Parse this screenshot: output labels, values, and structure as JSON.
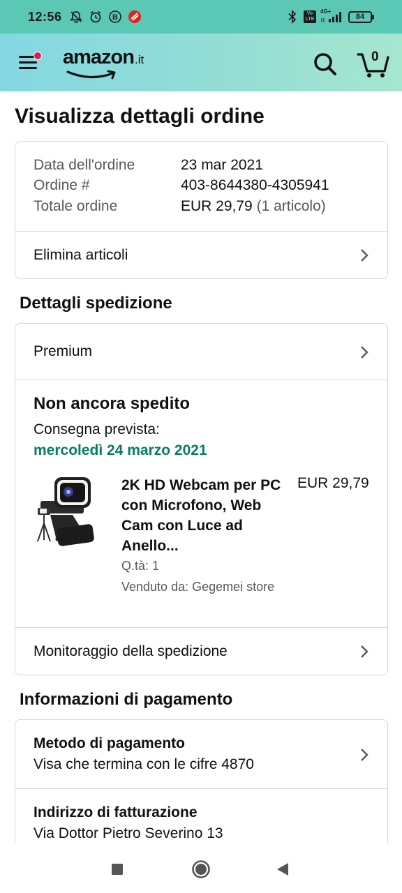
{
  "status_bar": {
    "time": "12:56",
    "left_icons": [
      "notifications-off-icon",
      "alarm-icon",
      "b-app-icon",
      "unicredit-app-icon"
    ],
    "right_icons": [
      "bluetooth-icon",
      "volte-icon",
      "signal-4g-icon"
    ],
    "network": "4G+",
    "volte": "Vo LTE",
    "battery": "84"
  },
  "header": {
    "logo_text": "amazon",
    "logo_tld": ".it",
    "cart_count": "0",
    "menu_badge_color": "#e3184f"
  },
  "page_title": "Visualizza dettagli ordine",
  "order_summary": {
    "rows": [
      {
        "label": "Data dell'ordine",
        "value": "23 mar 2021"
      },
      {
        "label": "Ordine #",
        "value": "403-8644380-4305941"
      },
      {
        "label": "Totale ordine",
        "value": "EUR 29,79",
        "value_note": "(1 articolo)"
      }
    ],
    "delete_items_label": "Elimina articoli"
  },
  "shipping": {
    "section_title": "Dettagli spedizione",
    "method": "Premium",
    "status": "Non ancora spedito",
    "delivery_label": "Consegna prevista:",
    "delivery_date": "mercoledì 24 marzo 2021",
    "delivery_date_color": "#067d62",
    "product": {
      "title": "2K HD Webcam per PC con Microfono, Web Cam con Luce ad Anello...",
      "price": "EUR 29,79",
      "quantity": "Q.tà: 1",
      "seller": "Venduto da: Gegemei store"
    },
    "tracking_label": "Monitoraggio della spedizione"
  },
  "payment": {
    "section_title": "Informazioni di pagamento",
    "method_title": "Metodo di pagamento",
    "method_value": "Visa che termina con le cifre 4870",
    "billing_title": "Indirizzo di fatturazione",
    "billing_value": "Via Dottor Pietro Severino 13"
  },
  "nav_bar": {
    "buttons": [
      "recents-square-icon",
      "home-circle-icon",
      "back-triangle-icon"
    ]
  }
}
